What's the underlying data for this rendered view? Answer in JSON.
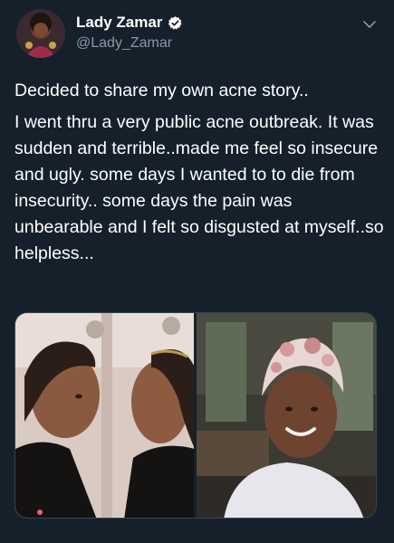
{
  "header": {
    "display_name": "Lady Zamar",
    "handle": "@Lady_Zamar"
  },
  "icons": {
    "verified": "verified-badge-icon",
    "menu": "chevron-down-icon"
  },
  "colors": {
    "background": "#15202b",
    "text_primary": "#ffffff",
    "text_secondary": "#8899a6",
    "verified_blue": "#1da1f2"
  },
  "tweet": {
    "paragraphs": [
      "Decided to share my own acne story..",
      "I went thru a very public acne outbreak. It was sudden and terrible..made me feel so insecure and ugly. some days I wanted to to die from insecurity.. some days the pain was unbearable and I felt so disgusted at myself..so helpless..."
    ]
  },
  "media": {
    "count": 2
  }
}
